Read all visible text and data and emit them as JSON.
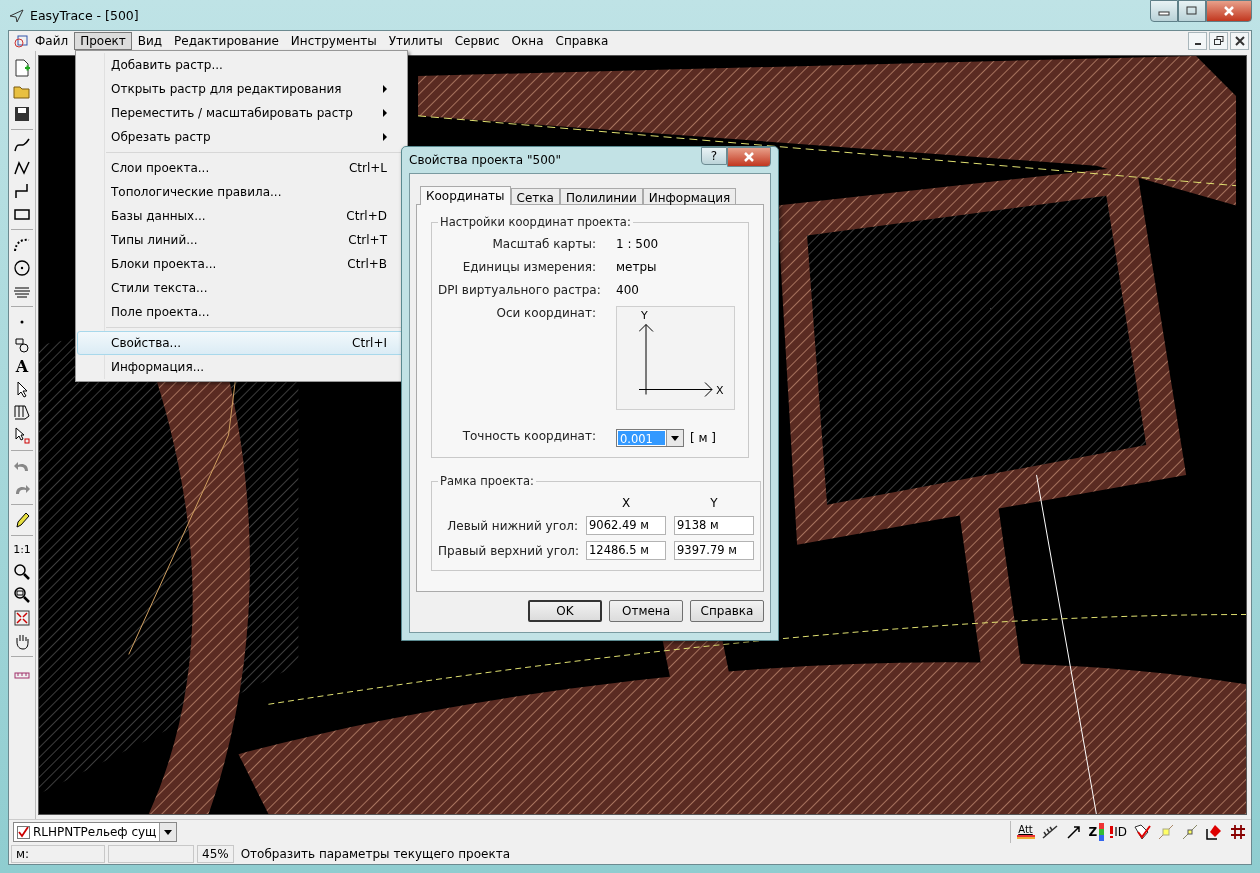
{
  "window": {
    "title": "EasyTrace - [500]"
  },
  "menu_bar": [
    {
      "label": "Файл",
      "selected": false
    },
    {
      "label": "Проект",
      "selected": true
    },
    {
      "label": "Вид",
      "selected": false
    },
    {
      "label": "Редактирование",
      "selected": false
    },
    {
      "label": "Инструменты",
      "selected": false
    },
    {
      "label": "Утилиты",
      "selected": false
    },
    {
      "label": "Сервис",
      "selected": false
    },
    {
      "label": "Окна",
      "selected": false
    },
    {
      "label": "Справка",
      "selected": false
    }
  ],
  "project_menu": {
    "groups": [
      [
        {
          "label": "Добавить растр...",
          "submenu": false,
          "selected": false
        },
        {
          "label": "Открыть растр для редактирования",
          "submenu": true,
          "selected": false
        },
        {
          "label": "Переместить / масштабировать растр",
          "submenu": true,
          "selected": false
        },
        {
          "label": "Обрезать растр",
          "submenu": true,
          "selected": false
        }
      ],
      [
        {
          "label": "Слои проекта...",
          "shortcut": "Ctrl+L",
          "submenu": false,
          "selected": false
        },
        {
          "label": "Топологические правила...",
          "submenu": false,
          "selected": false
        },
        {
          "label": "Базы данных...",
          "shortcut": "Ctrl+D",
          "submenu": false,
          "selected": false
        },
        {
          "label": "Типы линий...",
          "shortcut": "Ctrl+T",
          "submenu": false,
          "selected": false
        },
        {
          "label": "Блоки проекта...",
          "shortcut": "Ctrl+B",
          "submenu": false,
          "selected": false
        },
        {
          "label": "Стили текста...",
          "submenu": false,
          "selected": false
        },
        {
          "label": "Поле проекта...",
          "submenu": false,
          "selected": false
        }
      ],
      [
        {
          "label": "Свойства...",
          "shortcut": "Ctrl+I",
          "submenu": false,
          "selected": true
        },
        {
          "label": "Информация...",
          "submenu": false,
          "selected": false
        }
      ]
    ]
  },
  "tool_texts": {
    "text_tool": "A",
    "zoom_1_1": "1:1"
  },
  "dialog": {
    "title": "Свойства проекта \"500\"",
    "help": "?",
    "tabs": [
      {
        "label": "Координаты",
        "selected": true
      },
      {
        "label": "Сетка",
        "selected": false
      },
      {
        "label": "Полилинии",
        "selected": false
      },
      {
        "label": "Информация",
        "selected": false
      }
    ],
    "coordinates_group": {
      "title": "Настройки координат проекта:",
      "rows": [
        {
          "label": "Масштаб карты:",
          "value": "1 : 500"
        },
        {
          "label": "Единицы измерения:",
          "value": "метры"
        },
        {
          "label": "DPI виртуального растра:",
          "value": "400"
        }
      ],
      "axes": {
        "label": "Оси координат:",
        "x": "X",
        "y": "Y"
      },
      "precision": {
        "label": "Точность координат:",
        "value": "0.001",
        "unit": "[ м ]"
      }
    },
    "frame_group": {
      "title": "Рамка проекта:",
      "columns": [
        "X",
        "Y"
      ],
      "rows": [
        {
          "label": "Левый нижний угол:",
          "x": "9062.49 м",
          "y": "9138 м"
        },
        {
          "label": "Правый верхний угол:",
          "x": "12486.5 м",
          "y": "9397.79 м"
        }
      ]
    },
    "buttons": [
      {
        "label": "OK",
        "default": true
      },
      {
        "label": "Отмена",
        "default": false
      },
      {
        "label": "Справка",
        "default": false
      }
    ]
  },
  "layer_selector": {
    "checked": true,
    "value": "RLHPNTРельеф сущ"
  },
  "bottom_toolbar_texts": {
    "attributes": "Att",
    "z": "Z",
    "id": "ID"
  },
  "status_bar": {
    "coords_label": "м:",
    "zoom": "45%",
    "message": "Отобразить параметры текущего проекта"
  }
}
